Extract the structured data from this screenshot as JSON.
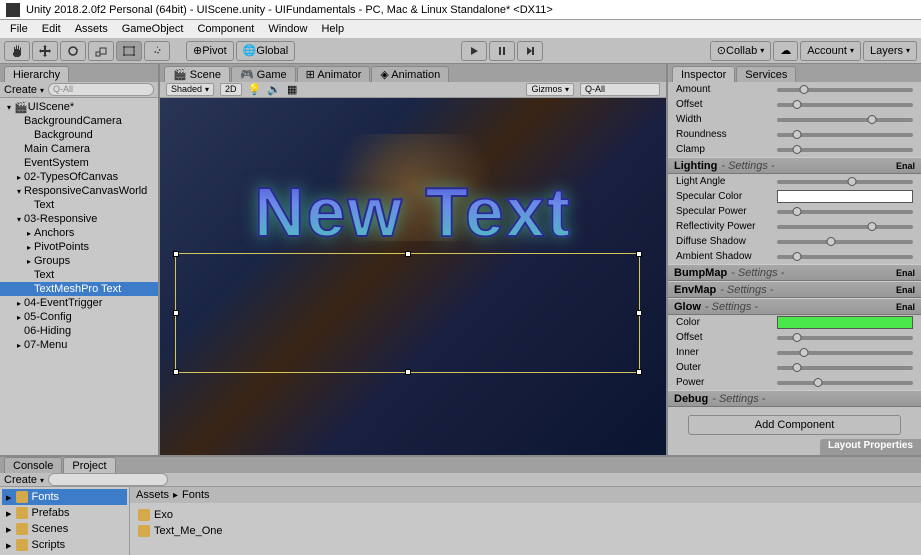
{
  "title": "Unity 2018.2.0f2 Personal (64bit) - UIScene.unity - UIFundamentals - PC, Mac & Linux Standalone* <DX11>",
  "menu": [
    "File",
    "Edit",
    "Assets",
    "GameObject",
    "Component",
    "Window",
    "Help"
  ],
  "toolbar": {
    "pivot": "Pivot",
    "global": "Global",
    "collab": "Collab",
    "account": "Account",
    "layers": "Layers"
  },
  "hierarchy": {
    "tab": "Hierarchy",
    "create": "Create",
    "search": "Q-All",
    "root": "UIScene*",
    "items": [
      {
        "t": "BackgroundCamera",
        "d": 1,
        "a": ""
      },
      {
        "t": "Background",
        "d": 2,
        "a": ""
      },
      {
        "t": "Main Camera",
        "d": 1,
        "a": ""
      },
      {
        "t": "EventSystem",
        "d": 1,
        "a": ""
      },
      {
        "t": "02-TypesOfCanvas",
        "d": 1,
        "a": "▸"
      },
      {
        "t": "ResponsiveCanvasWorld",
        "d": 1,
        "a": "▾"
      },
      {
        "t": "Text",
        "d": 2,
        "a": ""
      },
      {
        "t": "03-Responsive",
        "d": 1,
        "a": "▾"
      },
      {
        "t": "Anchors",
        "d": 2,
        "a": "▸"
      },
      {
        "t": "PivotPoints",
        "d": 2,
        "a": "▸"
      },
      {
        "t": "Groups",
        "d": 2,
        "a": "▸"
      },
      {
        "t": "Text",
        "d": 2,
        "a": ""
      },
      {
        "t": "TextMeshPro Text",
        "d": 2,
        "a": "",
        "sel": true
      },
      {
        "t": "04-EventTrigger",
        "d": 1,
        "a": "▸"
      },
      {
        "t": "05-Config",
        "d": 1,
        "a": "▸"
      },
      {
        "t": "06-Hiding",
        "d": 1,
        "a": ""
      },
      {
        "t": "07-Menu",
        "d": 1,
        "a": "▸"
      }
    ]
  },
  "scene": {
    "tabs": [
      "Scene",
      "Game",
      "Animator",
      "Animation"
    ],
    "shaded": "Shaded",
    "mode2d": "2D",
    "gizmos": "Gizmos",
    "search": "Q-All",
    "text": "New Text"
  },
  "inspector": {
    "tabs": [
      "Inspector",
      "Services"
    ],
    "props": [
      {
        "l": "Amount",
        "v": 20
      },
      {
        "l": "Offset",
        "v": 15
      },
      {
        "l": "Width",
        "v": 70
      },
      {
        "l": "Roundness",
        "v": 15
      },
      {
        "l": "Clamp",
        "v": 15
      }
    ],
    "sections": [
      {
        "h": "Lighting",
        "set": "- Settings -",
        "en": "Enal",
        "rows": [
          {
            "l": "Light Angle",
            "t": "s",
            "v": 55
          },
          {
            "l": "Specular Color",
            "t": "c",
            "c": "#ffffff"
          },
          {
            "l": "Specular Power",
            "t": "s",
            "v": 15
          },
          {
            "l": "Reflectivity Power",
            "t": "s",
            "v": 70
          },
          {
            "l": "Diffuse Shadow",
            "t": "s",
            "v": 40
          },
          {
            "l": "Ambient Shadow",
            "t": "s",
            "v": 15
          }
        ]
      },
      {
        "h": "BumpMap",
        "set": "- Settings -",
        "en": "Enal",
        "rows": []
      },
      {
        "h": "EnvMap",
        "set": "- Settings -",
        "en": "Enal",
        "rows": []
      },
      {
        "h": "Glow",
        "set": "- Settings -",
        "en": "Enal",
        "rows": [
          {
            "l": "Color",
            "t": "c",
            "c": "#4ae84a"
          },
          {
            "l": "Offset",
            "t": "s",
            "v": 15
          },
          {
            "l": "Inner",
            "t": "s",
            "v": 20
          },
          {
            "l": "Outer",
            "t": "s",
            "v": 15
          },
          {
            "l": "Power",
            "t": "s",
            "v": 30
          }
        ]
      },
      {
        "h": "Debug",
        "set": "- Settings -",
        "en": "",
        "rows": []
      }
    ],
    "addcomp": "Add Component",
    "layoutprops": "Layout Properties"
  },
  "project": {
    "tabs": [
      "Console",
      "Project"
    ],
    "tree": [
      "Fonts",
      "Prefabs",
      "Scenes",
      "Scripts"
    ],
    "crumb": [
      "Assets",
      "Fonts"
    ],
    "files": [
      "Exo",
      "Text_Me_One"
    ]
  }
}
